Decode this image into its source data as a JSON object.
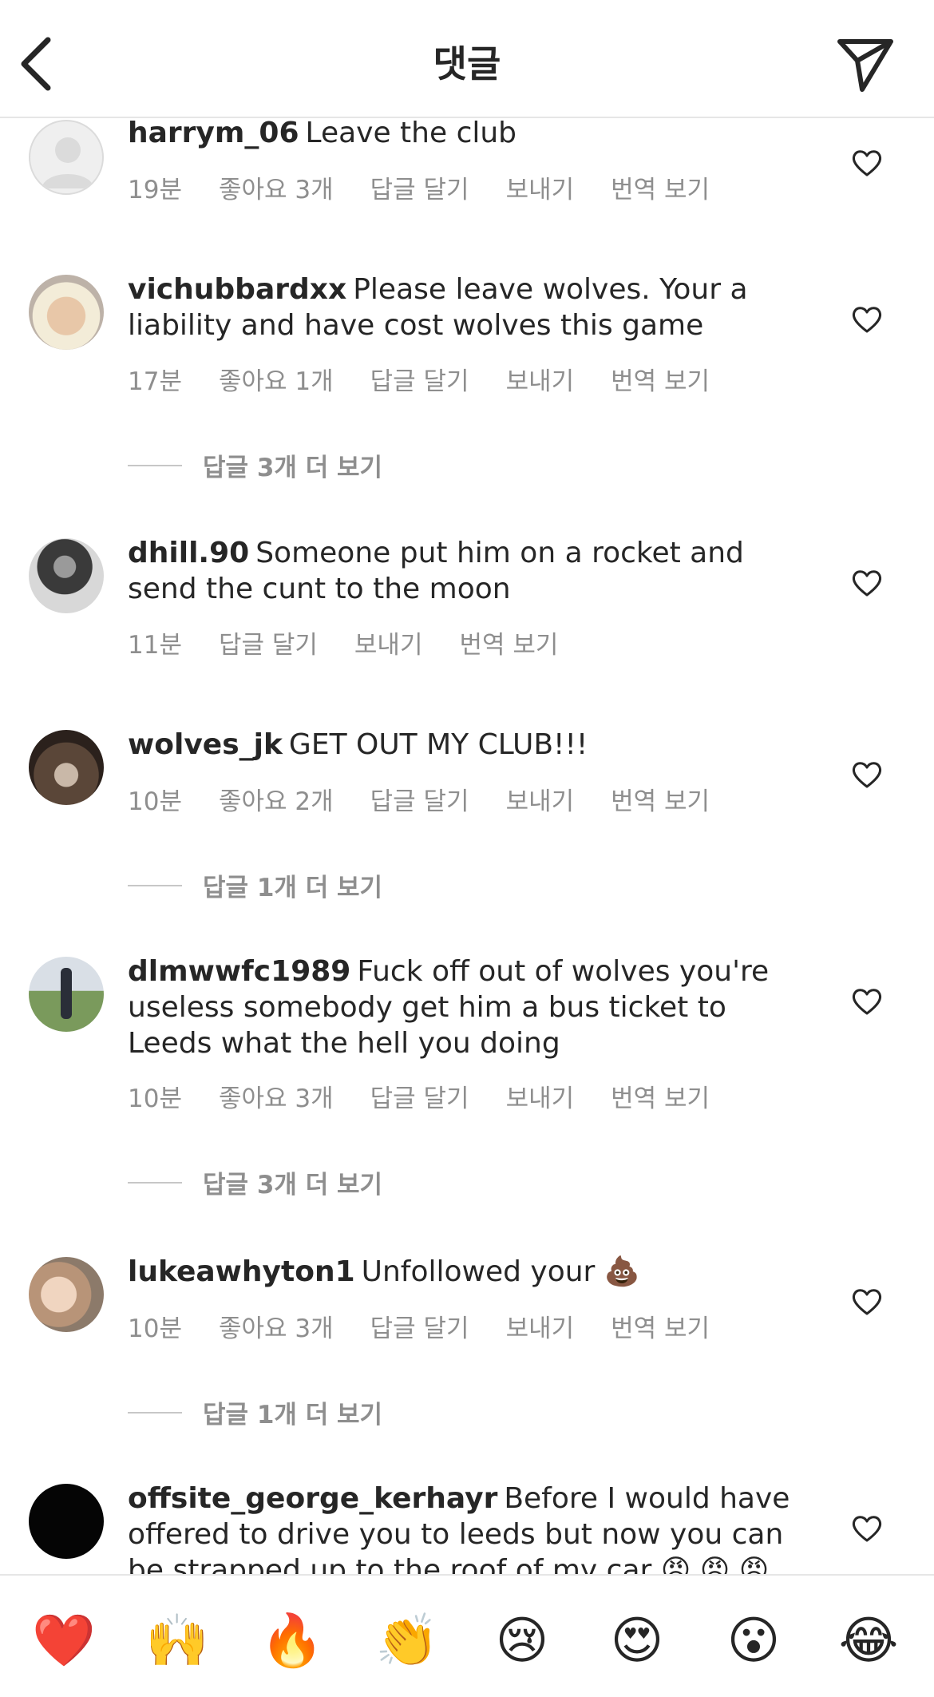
{
  "header": {
    "title": "댓글"
  },
  "labels": {
    "reply": "답글 달기",
    "send": "보내기",
    "translate": "번역 보기"
  },
  "comments": [
    {
      "username": "harrym_06",
      "text": "Leave the club",
      "time": "19분",
      "likes": "좋아요 3개"
    },
    {
      "username": "vichubbardxx",
      "text": "Please leave wolves. Your a liability and have cost wolves this game",
      "time": "17분",
      "likes": "좋아요 1개",
      "more_replies": "답글 3개 더 보기"
    },
    {
      "username": "dhill.90",
      "text": "Someone put him on a rocket and send the cunt to the moon",
      "time": "11분"
    },
    {
      "username": "wolves_jk",
      "text": "GET OUT MY CLUB!!!",
      "time": "10분",
      "likes": "좋아요 2개",
      "more_replies": "답글 1개 더 보기"
    },
    {
      "username": "dlmwwfc1989",
      "text": "Fuck off out of wolves you're useless somebody get him a bus ticket to Leeds what the hell you doing",
      "time": "10분",
      "likes": "좋아요 3개",
      "more_replies": "답글 3개 더 보기"
    },
    {
      "username": "lukeawhyton1",
      "text": "Unfollowed your 💩",
      "time": "10분",
      "likes": "좋아요 3개",
      "more_replies": "답글 1개 더 보기"
    },
    {
      "username": "offsite_george_kerhayr",
      "text": "Before I would have offered to drive you to leeds but now you can be strapped up to the roof of my car 😡 😡 😡"
    }
  ],
  "emoji_bar": [
    "❤️",
    "🙌",
    "🔥",
    "👏",
    "😢",
    "😍",
    "😮",
    "😂"
  ]
}
